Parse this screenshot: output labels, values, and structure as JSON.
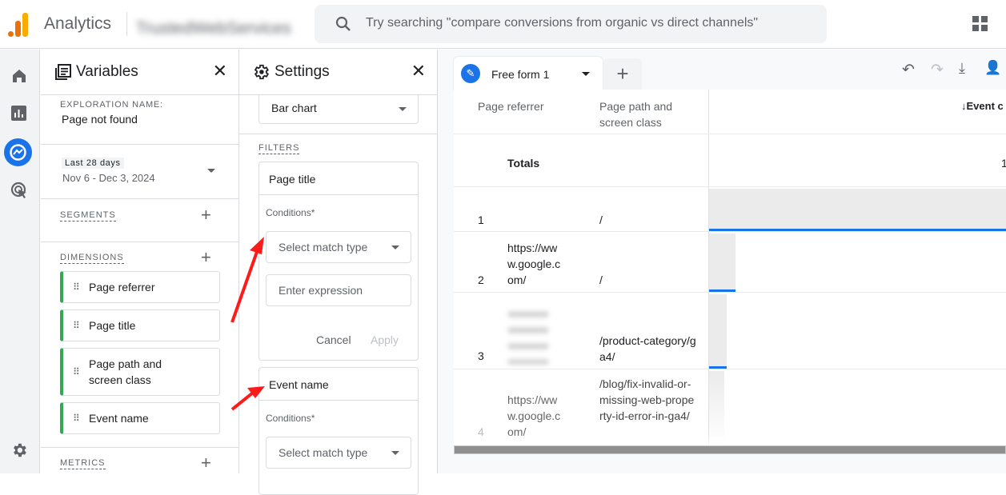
{
  "topbar": {
    "app_name": "Analytics",
    "account_name": "TrustedWebServices",
    "search_placeholder": "Try searching \"compare conversions from organic vs direct channels\""
  },
  "rail": {
    "items": [
      "home",
      "reports",
      "explore",
      "advertising"
    ],
    "active": "explore"
  },
  "variables": {
    "title": "Variables",
    "exploration_label": "EXPLORATION NAME:",
    "exploration_name": "Page not found",
    "date_badge": "Last 28 days",
    "date_range": "Nov 6 - Dec 3, 2024",
    "segments_label": "SEGMENTS",
    "dimensions_label": "DIMENSIONS",
    "dimensions": [
      "Page referrer",
      "Page title",
      "Page path and screen class",
      "Event name"
    ],
    "metrics_label": "METRICS"
  },
  "settings": {
    "title": "Settings",
    "visualization": "Bar chart",
    "filters_label": "FILTERS",
    "filters": [
      {
        "name": "Page title",
        "conditions_label": "Conditions*",
        "match_placeholder": "Select match type",
        "expression_placeholder": "Enter expression",
        "cancel": "Cancel",
        "apply": "Apply"
      },
      {
        "name": "Event name",
        "conditions_label": "Conditions*",
        "match_placeholder": "Select match type"
      }
    ]
  },
  "tab": {
    "name": "Free form 1",
    "add": "+"
  },
  "table": {
    "headers": [
      "Page referrer",
      "Page path and screen class",
      "↓Event c"
    ],
    "totals_label": "Totals",
    "totals_value": "1",
    "rows": [
      {
        "index": "1",
        "referrer": "",
        "path": "/",
        "bar": 1.0
      },
      {
        "index": "2",
        "referrer": "https://www.google.com/",
        "path": "/",
        "bar": 0.09
      },
      {
        "index": "3",
        "referrer": "",
        "path": "/product-category/ga4/",
        "bar": 0.06
      },
      {
        "index": "4",
        "referrer": "https://www.google.com/",
        "path": "/blog/fix-invalid-or-missing-web-property-id-error-in-ga4/",
        "bar": 0.05
      }
    ]
  },
  "colors": {
    "accent": "#1a73e8",
    "dimension": "#34a853",
    "annotation": "#ff0000"
  }
}
